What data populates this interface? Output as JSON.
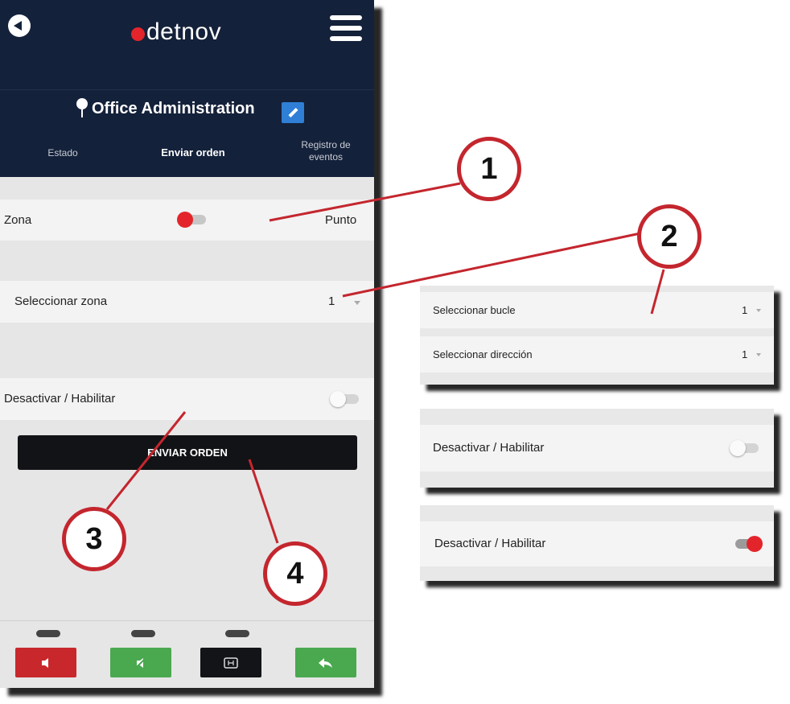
{
  "phone": {
    "logo_text": "detnov",
    "site_title": "Office Administration",
    "tabs": {
      "estado": "Estado",
      "enviar": "Enviar orden",
      "registro": "Registro de eventos"
    },
    "zona_label": "Zona",
    "punto_label": "Punto",
    "select_zona_label": "Seleccionar zona",
    "select_zona_value": "1",
    "deactivate_label": "Desactivar / Habilitar",
    "send_button": "ENVIAR ORDEN"
  },
  "panel_select": {
    "bucle_label": "Seleccionar bucle",
    "bucle_value": "1",
    "direccion_label": "Seleccionar dirección",
    "direccion_value": "1"
  },
  "panel_off": {
    "label": "Desactivar / Habilitar"
  },
  "panel_on": {
    "label": "Desactivar / Habilitar"
  },
  "callouts": [
    "1",
    "2",
    "3",
    "4"
  ],
  "colors": {
    "header": "#14213a",
    "accent_red": "#e3252b",
    "callout_ring": "#c4262e",
    "edit_blue": "#2f7fd6"
  }
}
